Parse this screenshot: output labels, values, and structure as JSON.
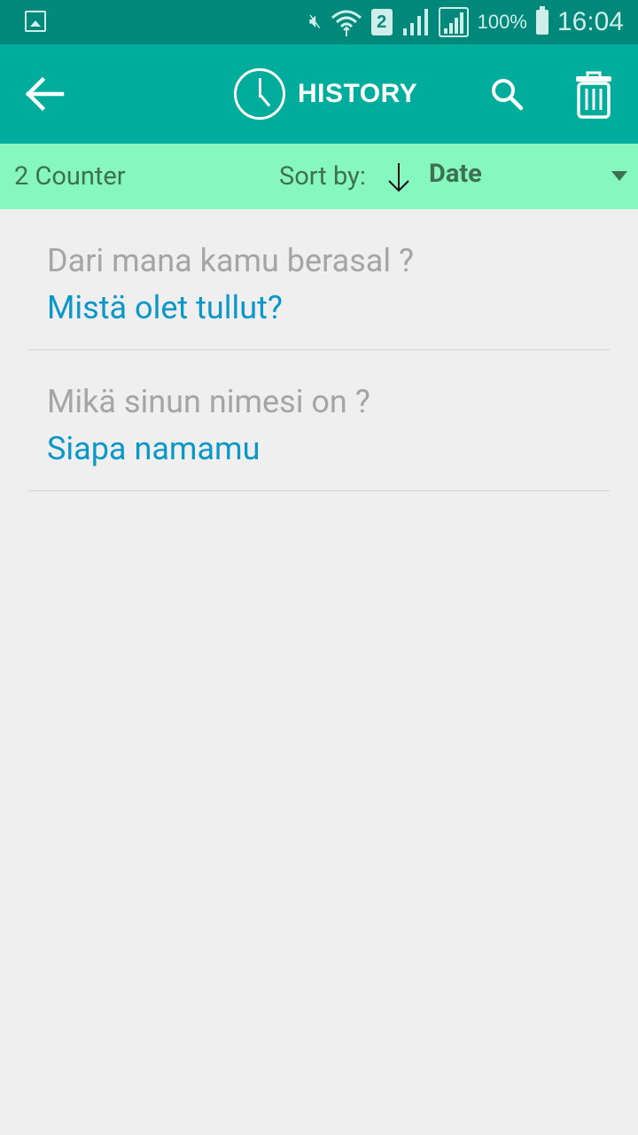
{
  "status_bar": {
    "time": "16:04",
    "battery": "100%",
    "sim_slot": "2",
    "icons": [
      "gallery-icon",
      "vibrate-mute-icon",
      "wifi-icon",
      "sim-icon",
      "signal-icon",
      "signal-roaming-icon",
      "battery-icon"
    ]
  },
  "appbar": {
    "title": "HISTORY",
    "back_icon": "arrow-left-icon",
    "title_icon": "clock-icon",
    "search_icon": "search-icon",
    "delete_icon": "trash-icon"
  },
  "sortbar": {
    "counter": "2 Counter",
    "sort_label": "Sort by:",
    "sort_direction_icon": "arrow-down-icon",
    "sort_value": "Date"
  },
  "history": [
    {
      "source": "Dari mana kamu berasal ?",
      "translation": "Mistä olet tullut?"
    },
    {
      "source": "Mikä sinun nimesi on ?",
      "translation": "Siapa namamu"
    }
  ],
  "colors": {
    "statusbar": "#00897b",
    "appbar": "#00ad9c",
    "sortbar": "#86f7bf",
    "source_text": "#a5a5a5",
    "translation_text": "#0b97c7"
  }
}
